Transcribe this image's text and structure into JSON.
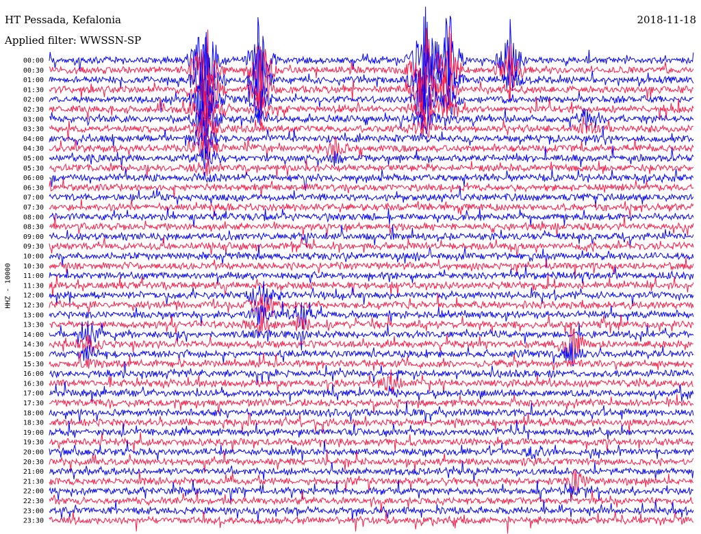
{
  "header": {
    "station": "HT Pessada, Kefalonia",
    "filter": "Applied filter: WWSSN-SP",
    "date": "2018-11-18"
  },
  "chart_data": {
    "type": "line",
    "ylabel": "HHZ - 10000",
    "row_labels": [
      "00:00",
      "00:30",
      "01:00",
      "01:30",
      "02:00",
      "02:30",
      "03:00",
      "03:30",
      "04:00",
      "04:30",
      "05:00",
      "05:30",
      "06:00",
      "06:30",
      "07:00",
      "07:30",
      "08:00",
      "08:30",
      "09:00",
      "09:30",
      "10:00",
      "10:30",
      "11:00",
      "11:30",
      "12:00",
      "12:30",
      "13:00",
      "13:30",
      "14:00",
      "14:30",
      "15:00",
      "15:30",
      "16:00",
      "16:30",
      "17:00",
      "17:30",
      "18:00",
      "18:30",
      "19:00",
      "19:30",
      "20:00",
      "20:30",
      "21:00",
      "21:30",
      "22:00",
      "22:30",
      "23:00",
      "23:30"
    ],
    "colors": {
      "even_rows": "#0000ff",
      "odd_rows": "#ff1744"
    },
    "grid": false
  }
}
